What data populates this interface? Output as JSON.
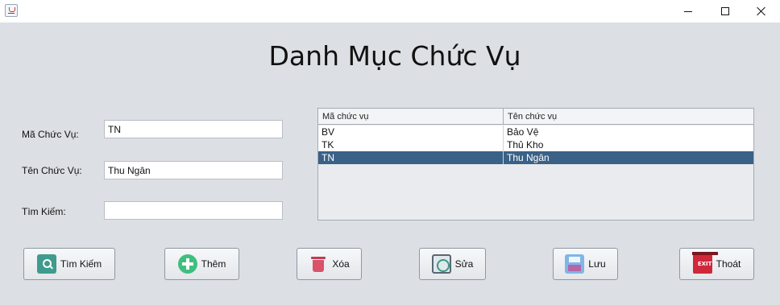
{
  "window": {
    "minimize_icon": "minimize-icon",
    "maximize_icon": "maximize-icon",
    "close_icon": "close-icon"
  },
  "page": {
    "title": "Danh Mục Chức Vụ"
  },
  "form": {
    "code_label": "Mã Chức Vụ:",
    "code_value": "TN",
    "name_label": "Tên Chức Vụ:",
    "name_value": "Thu Ngân",
    "search_label": "Tìm Kiếm:",
    "search_value": ""
  },
  "table": {
    "columns": [
      "Mã chức vụ",
      "Tên chức vụ"
    ],
    "rows": [
      {
        "code": "BV",
        "name": "Bảo Vệ"
      },
      {
        "code": "TK",
        "name": "Thủ Kho"
      },
      {
        "code": "TN",
        "name": "Thu Ngân"
      }
    ],
    "selected_row": 2
  },
  "buttons": {
    "search": "Tìm Kiếm",
    "add": "Thêm",
    "delete": "Xóa",
    "edit": "Sửa",
    "save": "Lưu",
    "exit": "Thoát",
    "exit_icon_text": "EXIT"
  },
  "colors": {
    "background": "#dcdfe4",
    "selection": "#3a6186"
  }
}
